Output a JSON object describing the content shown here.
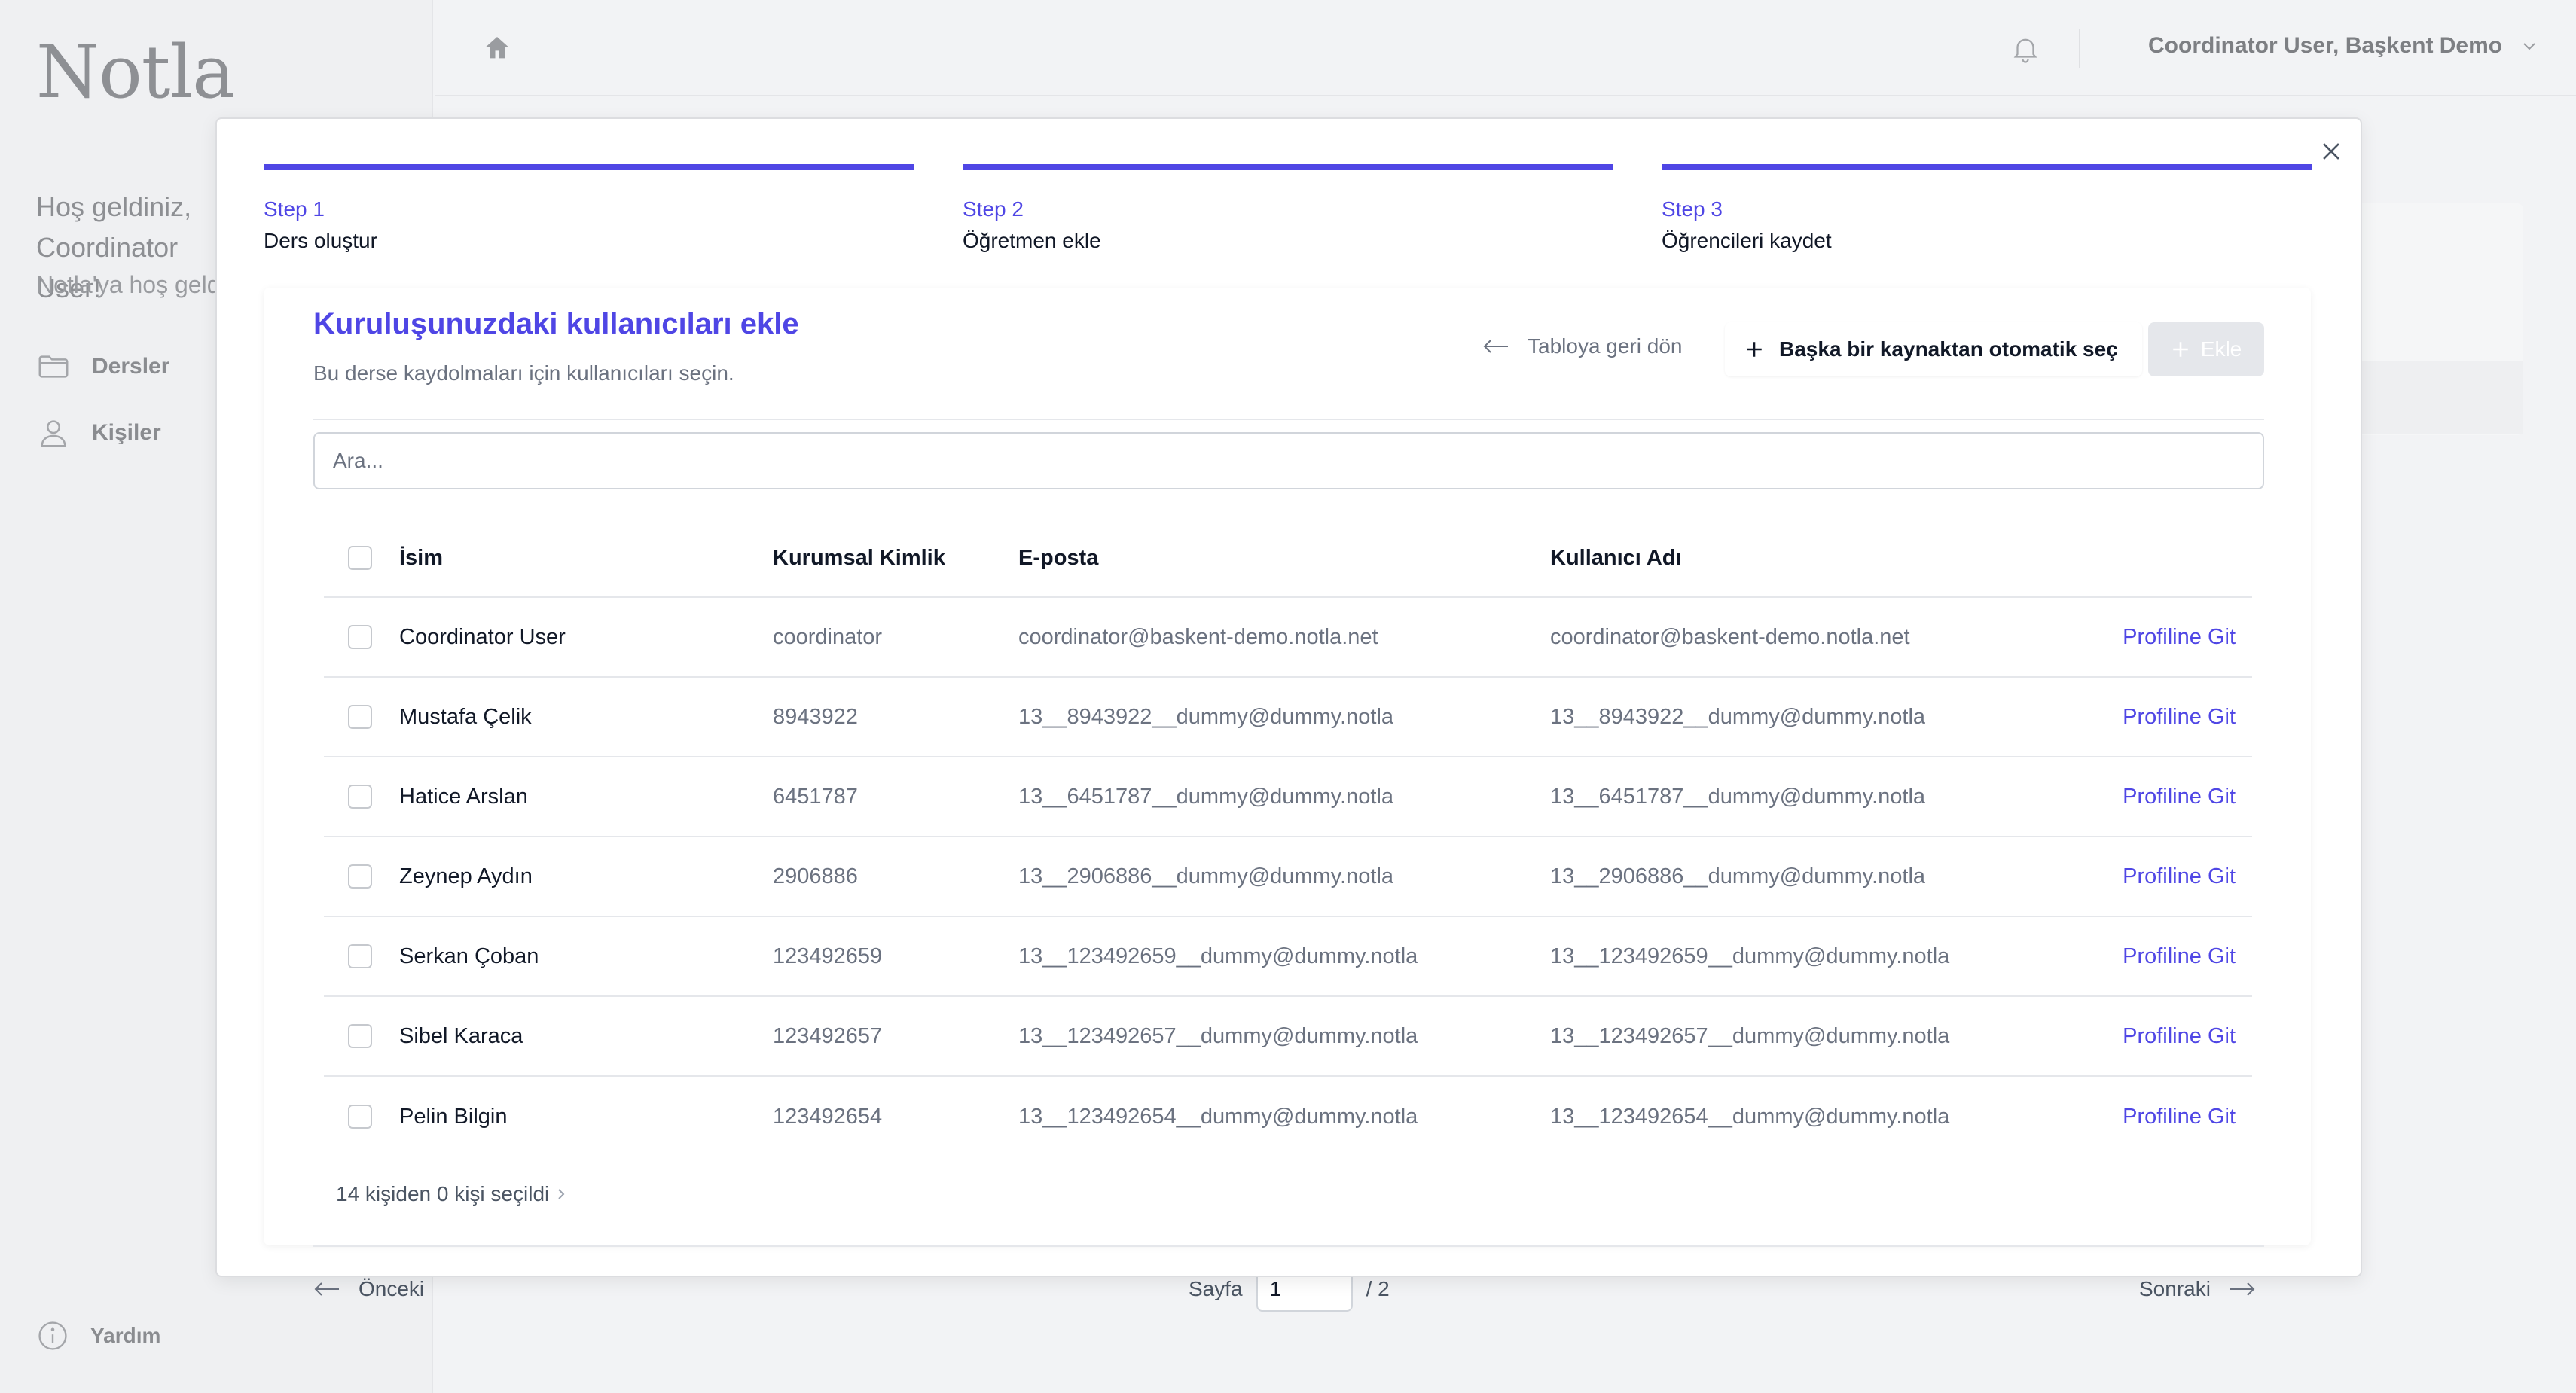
{
  "app": {
    "logo": "Notla"
  },
  "sidebar": {
    "welcome": "Hoş geldiniz, Coordinator User!",
    "welcome_sub": "Notla'ya hoş geldiniz",
    "items": [
      {
        "label": "Dersler",
        "icon": "folder-icon"
      },
      {
        "label": "Kişiler",
        "icon": "user-icon"
      }
    ],
    "help_label": "Yardım"
  },
  "header": {
    "user_menu": "Coordinator User, Başkent Demo"
  },
  "steps": [
    {
      "num": "Step 1",
      "name": "Ders oluştur"
    },
    {
      "num": "Step 2",
      "name": "Öğretmen ekle"
    },
    {
      "num": "Step 3",
      "name": "Öğrencileri kaydet"
    }
  ],
  "panel": {
    "title": "Kuruluşunuzdaki kullanıcıları ekle",
    "subtitle": "Bu derse kaydolmaları için kullanıcıları seçin.",
    "back_label": "Tabloya geri dön",
    "auto_label": "Başka bir kaynaktan otomatik seç",
    "add_label": "Ekle",
    "search_placeholder": "Ara..."
  },
  "table": {
    "columns": {
      "name": "İsim",
      "id": "Kurumsal Kimlik",
      "email": "E-posta",
      "username": "Kullanıcı Adı"
    },
    "link_label": "Profiline Git",
    "rows": [
      {
        "name": "Coordinator User",
        "id": "coordinator",
        "email": "coordinator@baskent-demo.notla.net",
        "username": "coordinator@baskent-demo.notla.net"
      },
      {
        "name": "Mustafa Çelik",
        "id": "8943922",
        "email": "13__8943922__dummy@dummy.notla",
        "username": "13__8943922__dummy@dummy.notla"
      },
      {
        "name": "Hatice Arslan",
        "id": "6451787",
        "email": "13__6451787__dummy@dummy.notla",
        "username": "13__6451787__dummy@dummy.notla"
      },
      {
        "name": "Zeynep Aydın",
        "id": "2906886",
        "email": "13__2906886__dummy@dummy.notla",
        "username": "13__2906886__dummy@dummy.notla"
      },
      {
        "name": "Serkan Çoban",
        "id": "123492659",
        "email": "13__123492659__dummy@dummy.notla",
        "username": "13__123492659__dummy@dummy.notla"
      },
      {
        "name": "Sibel Karaca",
        "id": "123492657",
        "email": "13__123492657__dummy@dummy.notla",
        "username": "13__123492657__dummy@dummy.notla"
      },
      {
        "name": "Pelin Bilgin",
        "id": "123492654",
        "email": "13__123492654__dummy@dummy.notla",
        "username": "13__123492654__dummy@dummy.notla"
      }
    ],
    "selected_summary": "14 kişiden 0 kişi seçildi"
  },
  "pagination": {
    "prev_label": "Önceki",
    "page_label": "Sayfa",
    "page_value": "1",
    "total_label": "/ 2",
    "next_label": "Sonraki"
  },
  "colors": {
    "accent": "#4f46e5",
    "text": "#111827",
    "muted": "#6b7280",
    "border": "#e5e7eb"
  }
}
